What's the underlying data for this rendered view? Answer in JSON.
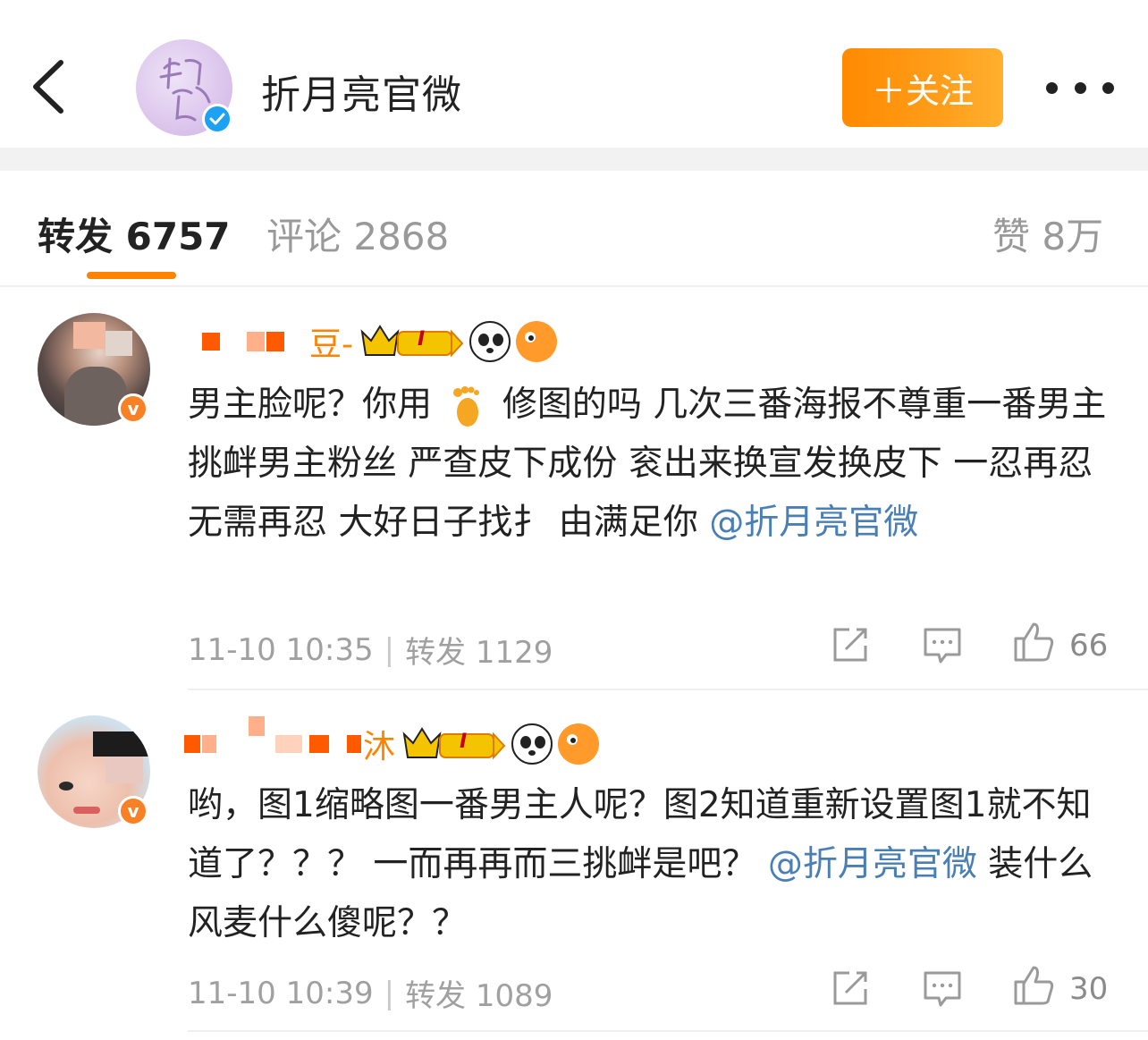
{
  "header": {
    "back_icon": "chevron-left-icon",
    "account_name": "折月亮官微",
    "follow_label": "＋关注",
    "more_icon": "more-dots-icon",
    "verified_color": "#1da1f2"
  },
  "tabs": {
    "repost_label": "转发 6757",
    "comment_label": "评论 2868",
    "like_label": "赞 8万",
    "active": "repost",
    "accent_color": "#ff8200"
  },
  "comments": [
    {
      "username_visible": "豆-",
      "badges": [
        "crown-level-badge",
        "panda-emoji",
        "fish-emoji"
      ],
      "level_text": "I",
      "text_before_emoji": "男主脸呢？你用",
      "emoji": "foot-emoji",
      "text_after_emoji": "修图的吗 几次三番海报不尊重一番男主 挑衅男主粉丝 严查皮下成份 衮出来换宣发换皮下 一忍再忍无需再忍 大好日子找扌 由满足你 ",
      "mention": "@折月亮官微",
      "time": "11-10 10:35",
      "repost_label": "转发 1129",
      "like_count": "66"
    },
    {
      "username_visible": "沐",
      "badges": [
        "crown-level-badge",
        "panda-emoji",
        "fish-emoji"
      ],
      "level_text": "I",
      "text_main": "哟，图1缩略图一番男主人呢？图2知道重新设置图1就不知道了？？？ 一而再再而三挑衅是吧？",
      "mention": "@折月亮官微",
      "text_tail": " 装什么风麦什么傻呢？？",
      "time": "11-10 10:39",
      "repost_label": "转发 1089",
      "like_count": "30"
    }
  ]
}
